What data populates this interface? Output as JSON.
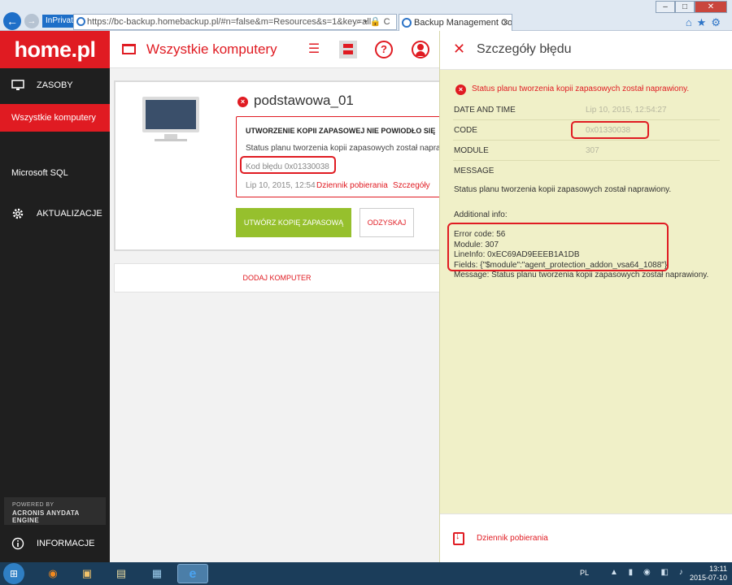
{
  "browser": {
    "inprivate_label": "InPrivate",
    "url": "https://bc-backup.homebackup.pl/#n=false&m=Resources&s=1&key=all",
    "tab_title": "Backup Management Cons...",
    "tab_close": "×",
    "win_min": "–",
    "win_max": "□",
    "win_close": "✕",
    "favs": "⌂★⚙",
    "addr_tools": "⌕ ▾ 🔒 C"
  },
  "sidebar": {
    "logo": "home.pl",
    "items": [
      {
        "label": "ZASOBY",
        "icon": "monitor-icon"
      },
      {
        "label": "Wszystkie komputery",
        "active": true
      },
      {
        "label": "Microsoft SQL"
      },
      {
        "label": "AKTUALIZACJE",
        "icon": "gear-icon"
      },
      {
        "label": "INFORMACJE",
        "icon": "info-icon"
      }
    ],
    "powered_line1": "POWERED BY",
    "powered_line2": "ACRONIS ANYDATA ENGINE"
  },
  "header": {
    "title": "Wszystkie komputery",
    "help_glyph": "?",
    "list_glyph": "☰"
  },
  "machine": {
    "name": "podstawowa_01",
    "error_title": "UTWORZENIE KOPII ZAPASOWEJ NIE POWIODŁO SIĘ",
    "error_desc": "Status planu tworzenia kopii zapasowych został naprawiony.",
    "error_code": "Kod błędu 0x01330038",
    "date": "Lip 10, 2015, 12:54",
    "link_log": "Dziennik pobierania",
    "link_details": "Szczegóły",
    "btn_backup": "UTWÓRZ KOPIĘ ZAPASOWĄ",
    "btn_recover": "ODZYSKAJ",
    "err_glyph": "×"
  },
  "add_computer": "DODAJ KOMPUTER",
  "details": {
    "title": "Szczegóły błędu",
    "close_glyph": "✕",
    "status": "Status planu tworzenia kopii zapasowych został naprawiony.",
    "rows": [
      {
        "key": "DATE AND TIME",
        "value": "Lip 10, 2015, 12:54:27"
      },
      {
        "key": "CODE",
        "value": "0x01330038"
      },
      {
        "key": "MODULE",
        "value": "307"
      },
      {
        "key": "MESSAGE",
        "value": ""
      }
    ],
    "message": "Status planu tworzenia kopii zapasowych został naprawiony.",
    "additional_title": "Additional info:",
    "additional_lines": [
      "Error code: 56",
      "Module: 307",
      "LineInfo: 0xEC69AD9EEEB1A1DB",
      "Fields: {\"$module\":\"agent_protection_addon_vsa64_1088\"}",
      "Message: Status planu tworzenia kopii zapasowych został naprawiony."
    ],
    "footer_link": "Dziennik pobierania"
  },
  "taskbar": {
    "lang": "PL",
    "time": "13:11",
    "date": "2015-07-10",
    "tray_icons": "▲ ▮ ◉ ◧ ♪",
    "start_glyph": "⊞",
    "apps": [
      {
        "name": "firefox",
        "glyph": "◉"
      },
      {
        "name": "explorer",
        "glyph": "▣"
      },
      {
        "name": "files",
        "glyph": "▤"
      },
      {
        "name": "window",
        "glyph": "▦"
      },
      {
        "name": "ie",
        "glyph": "e"
      }
    ]
  },
  "colors": {
    "accent": "#e01b22",
    "sidebar_bg": "#1f1f1f",
    "panel_bg": "#f0f0c8",
    "green_button": "#96c02d"
  }
}
